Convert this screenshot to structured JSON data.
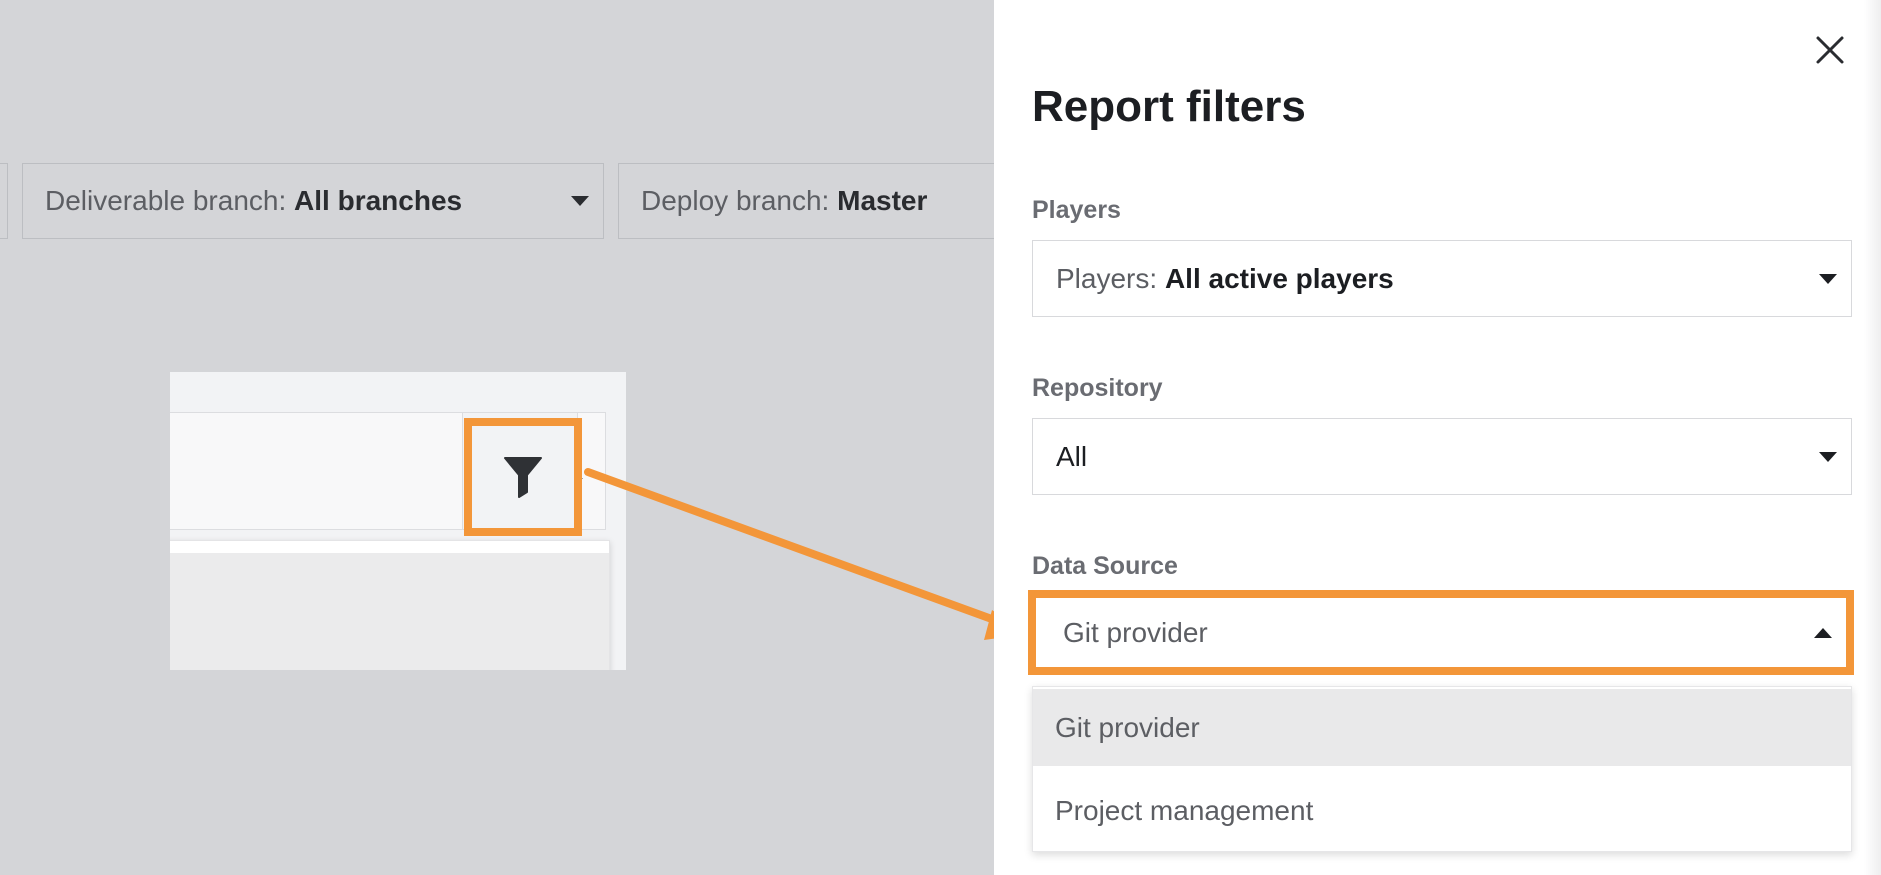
{
  "background_filters": {
    "deliverable_branch": {
      "label": "Deliverable branch:",
      "value": "All branches"
    },
    "deploy_branch": {
      "label": "Deploy branch:",
      "value": "Master"
    }
  },
  "inset": {
    "filter_button_icon": "filter-funnel-icon"
  },
  "panel": {
    "title": "Report filters",
    "close_icon": "close-icon",
    "players": {
      "label": "Players",
      "select_prefix": "Players:",
      "select_value": "All active players"
    },
    "repository": {
      "label": "Repository",
      "select_value": "All"
    },
    "data_source": {
      "label": "Data Source",
      "select_value": "Git provider",
      "options": [
        "Git provider",
        "Project management"
      ]
    }
  },
  "colors": {
    "highlight": "#f39639",
    "overlay": "#d4d5d8",
    "panel": "#ffffff"
  }
}
